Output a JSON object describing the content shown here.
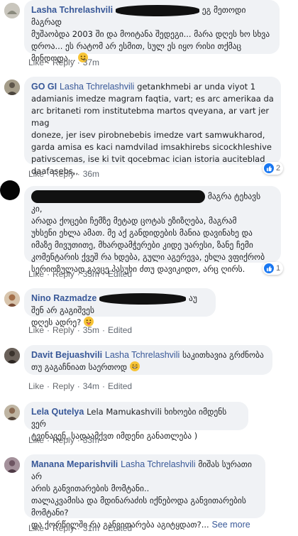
{
  "actions": {
    "like": "Like",
    "reply": "Reply",
    "separator": "·",
    "edited": "Edited"
  },
  "comments": [
    {
      "name": "Lasha Tchrelashvili",
      "text_after_redaction": "ეგ მეთოდი მაგრად",
      "text_lines": [
        "მუშაობდა 2003 ში და მოიტანა შედეგი... მარა დღეს ხო სხვა",
        "დროა... ეს რატომ არ ესმით, სულ ეს იყო რისი თქმაც",
        "მინდოდა..."
      ],
      "time": "37m"
    },
    {
      "name": "GO GI",
      "mention": "Lasha Tchrelashvili",
      "text_first": "getankhmebi ar unda viyot 1",
      "text_lines": [
        "adamianis imedze magram faqtia, vart; es arc amerikaa da",
        "arc britaneti rom institutebma martos qveyana, ar vart jer mag",
        "doneze, jer isev pirobnebebis imedze vart samwukharod,",
        "garda amisa es kaci namdvilad imsakhirebs sicockhleshive",
        "pativscemas, ise ki tvit qocebmac ician istoria auciteblad",
        "daafasebs,,"
      ],
      "time": "36m",
      "reactions": "2"
    },
    {
      "text_after_redaction": "მაგრა ტეხავს კი,",
      "text_lines": [
        "არადა ქოცები ჩემზე მეტად ცოტას ეზიზღება, მაგრამ",
        "უხსენი ეხლა ამათ. მე აქ განდიდების მანია დავინახე და",
        "იმაზე მივუთითე, მხარდამჭერები კიდე უარესი, ზანე ჩემი",
        "კომენტარის ქვეშ რა ხდება, გული აგერევა, ეხლა ვფიქრობ",
        "სერიოზულად გავცე პასუხი ძთუ დავიკიდო, არც ღირს."
      ],
      "time": "35m",
      "edited": true,
      "reactions": "1"
    },
    {
      "name": "Nino Razmadze",
      "text_after_redaction": "აუ შენ არ გაგიშვეს",
      "text_lines": [
        "დღეს ადრე?"
      ],
      "time": "35m",
      "edited": true
    },
    {
      "name": "Davit Bejuashvili",
      "mention": "Lasha Tchrelashvili",
      "text_first": "საკითხავია გრძნობა",
      "text_lines": [
        "თუ გაგაჩნიათ საერთოდ"
      ],
      "time": "34m",
      "edited": true
    },
    {
      "name": "Lela Qutelya",
      "text_first": "Lela Mamukashvili ხიხოები იმდენს ვერ",
      "text_lines": [
        "ტვინავენ, სადაამქვთ იმდენი განათლება )"
      ],
      "time": "33m"
    },
    {
      "name": "Manana Meparishvili",
      "mention": "Lasha Tchrelashvili",
      "text_first": "მიშას სურათი არ",
      "text_lines": [
        "არის განვითარების მომტანი..",
        "თალაკვამისა და მდინარაძის იქნებოდა განვითარების",
        "მომტანი?",
        "და ქორწილში რა განვითარება აგიტყდათ?..."
      ],
      "see_more": "See more",
      "time": "31m",
      "edited": true
    }
  ]
}
